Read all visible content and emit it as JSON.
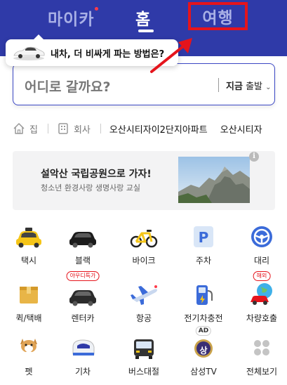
{
  "header": {
    "tabs": [
      {
        "label": "마이카"
      },
      {
        "label": "홈"
      },
      {
        "label": "여행"
      }
    ]
  },
  "tooltip": {
    "text": "내차, 더 비싸게 파는 방법은?"
  },
  "search": {
    "placeholder": "어디로 갈까요?",
    "depart_now": "지금",
    "depart_label": "출발"
  },
  "quick_destinations": {
    "home": "집",
    "office": "회사",
    "recent": [
      "오산시티자이2단지아파트",
      "오산시티자"
    ]
  },
  "banner": {
    "title": "설악산 국립공원으로 가자!",
    "subtitle": "청소년 환경사랑 생명사랑 교실"
  },
  "services": [
    {
      "label": "택시",
      "icon": "taxi-icon"
    },
    {
      "label": "블랙",
      "icon": "black-car-icon"
    },
    {
      "label": "바이크",
      "icon": "bike-icon"
    },
    {
      "label": "주차",
      "icon": "parking-icon"
    },
    {
      "label": "대리",
      "icon": "steering-wheel-icon"
    },
    {
      "label": "퀵/택배",
      "icon": "parcel-box-icon"
    },
    {
      "label": "렌터카",
      "icon": "rental-car-icon",
      "badge": "야우디특가"
    },
    {
      "label": "항공",
      "icon": "airplane-icon"
    },
    {
      "label": "전기차충전",
      "icon": "ev-charger-icon"
    },
    {
      "label": "차량호출",
      "icon": "global-car-icon",
      "badge": "해외"
    },
    {
      "label": "펫",
      "icon": "pet-dog-icon"
    },
    {
      "label": "기차",
      "icon": "train-icon"
    },
    {
      "label": "버스대절",
      "icon": "bus-icon"
    },
    {
      "label": "삼성TV",
      "icon": "samsung-tv-icon",
      "badge": "AD",
      "badge2": "상"
    },
    {
      "label": "전체보기",
      "icon": "grid-dots-icon"
    }
  ],
  "colors": {
    "header_bg": "#2f3aa8",
    "accent": "#3b47c4",
    "highlight": "#e5141c"
  }
}
